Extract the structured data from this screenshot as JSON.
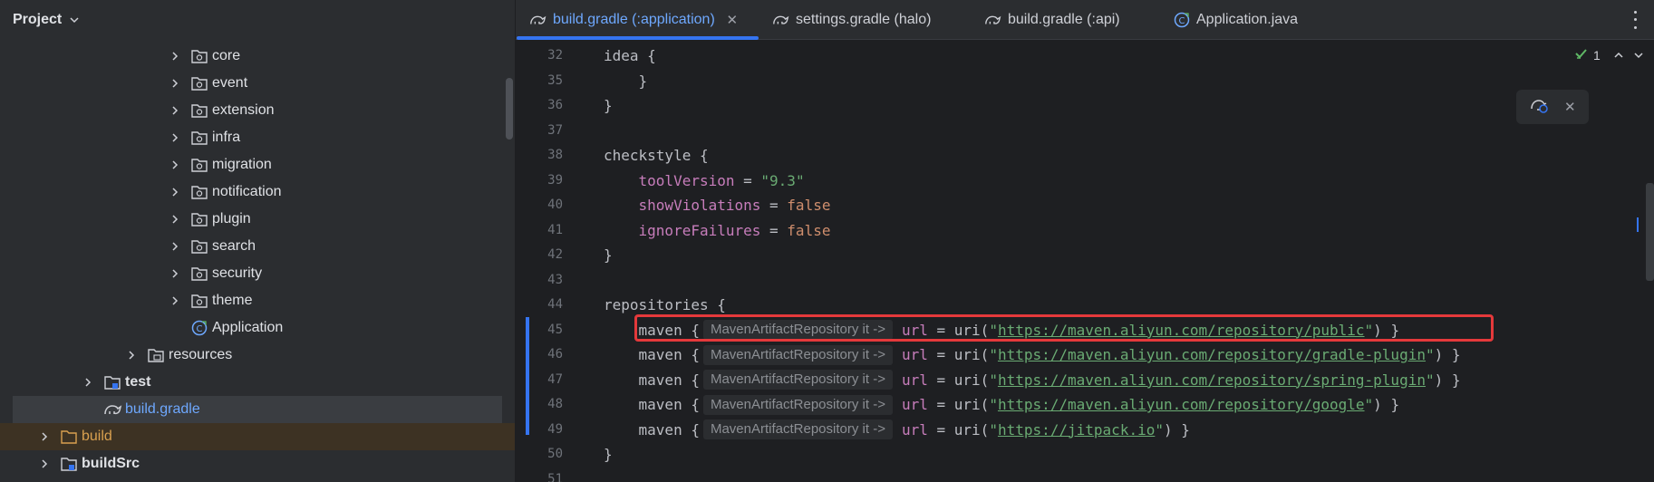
{
  "project": {
    "title": "Project",
    "tree": [
      {
        "label": "core",
        "depth": 3,
        "kind": "package",
        "arrow": true
      },
      {
        "label": "event",
        "depth": 3,
        "kind": "package",
        "arrow": true
      },
      {
        "label": "extension",
        "depth": 3,
        "kind": "package",
        "arrow": true
      },
      {
        "label": "infra",
        "depth": 3,
        "kind": "package",
        "arrow": true
      },
      {
        "label": "migration",
        "depth": 3,
        "kind": "package",
        "arrow": true
      },
      {
        "label": "notification",
        "depth": 3,
        "kind": "package",
        "arrow": true
      },
      {
        "label": "plugin",
        "depth": 3,
        "kind": "package",
        "arrow": true
      },
      {
        "label": "search",
        "depth": 3,
        "kind": "package",
        "arrow": true
      },
      {
        "label": "security",
        "depth": 3,
        "kind": "package",
        "arrow": true
      },
      {
        "label": "theme",
        "depth": 3,
        "kind": "package",
        "arrow": true
      },
      {
        "label": "Application",
        "depth": 3,
        "kind": "class",
        "arrow": false
      },
      {
        "label": "resources",
        "depth": 2,
        "kind": "resources",
        "arrow": true
      },
      {
        "label": "test",
        "depth": 1,
        "kind": "testfolder",
        "arrow": true,
        "bold": true
      },
      {
        "label": "build.gradle",
        "depth": 1,
        "kind": "gradle",
        "arrow": false,
        "selected": true
      },
      {
        "label": "build",
        "depth": 0,
        "kind": "excluded",
        "arrow": true,
        "excluded": true
      },
      {
        "label": "buildSrc",
        "depth": 0,
        "kind": "module",
        "arrow": true,
        "bold": true
      }
    ]
  },
  "tabs": [
    {
      "label": "build.gradle (:application)",
      "icon": "gradle-icon",
      "active": true
    },
    {
      "label": "settings.gradle (halo)",
      "icon": "gradle-icon",
      "active": false
    },
    {
      "label": "build.gradle (:api)",
      "icon": "gradle-icon",
      "active": false
    },
    {
      "label": "Application.java",
      "icon": "java-class-icon",
      "active": false
    }
  ],
  "editor": {
    "inspection_count": "1",
    "lines": [
      {
        "num": "32",
        "segments": [
          {
            "t": "idea {",
            "c": ""
          }
        ]
      },
      {
        "num": "35",
        "segments": [
          {
            "t": "    }",
            "c": ""
          }
        ]
      },
      {
        "num": "36",
        "segments": [
          {
            "t": "}",
            "c": ""
          }
        ]
      },
      {
        "num": "37",
        "segments": []
      },
      {
        "num": "38",
        "segments": [
          {
            "t": "checkstyle {",
            "c": ""
          }
        ]
      },
      {
        "num": "39",
        "segments": [
          {
            "t": "    ",
            "c": ""
          },
          {
            "t": "toolVersion",
            "c": "kw-prop"
          },
          {
            "t": " = ",
            "c": ""
          },
          {
            "t": "\"9.3\"",
            "c": "str"
          }
        ]
      },
      {
        "num": "40",
        "segments": [
          {
            "t": "    ",
            "c": ""
          },
          {
            "t": "showViolations",
            "c": "kw-prop"
          },
          {
            "t": " = ",
            "c": ""
          },
          {
            "t": "false",
            "c": "kw-val"
          }
        ]
      },
      {
        "num": "41",
        "segments": [
          {
            "t": "    ",
            "c": ""
          },
          {
            "t": "ignoreFailures",
            "c": "kw-prop"
          },
          {
            "t": " = ",
            "c": ""
          },
          {
            "t": "false",
            "c": "kw-val"
          }
        ]
      },
      {
        "num": "42",
        "segments": [
          {
            "t": "}",
            "c": ""
          }
        ]
      },
      {
        "num": "43",
        "segments": []
      },
      {
        "num": "44",
        "segments": [
          {
            "t": "repositories {",
            "c": ""
          }
        ]
      },
      {
        "num": "45",
        "segments": [
          {
            "t": "    maven {",
            "c": ""
          },
          {
            "t": "MavenArtifactRepository it ->",
            "c": "hint"
          },
          {
            "t": "url",
            "c": "kw-prop"
          },
          {
            "t": " = uri(",
            "c": ""
          },
          {
            "t": "\"",
            "c": "str"
          },
          {
            "t": "https://maven.aliyun.com/repository/public",
            "c": "url"
          },
          {
            "t": "\"",
            "c": "str"
          },
          {
            "t": ") }",
            "c": ""
          }
        ]
      },
      {
        "num": "46",
        "segments": [
          {
            "t": "    maven {",
            "c": ""
          },
          {
            "t": "MavenArtifactRepository it ->",
            "c": "hint"
          },
          {
            "t": "url",
            "c": "kw-prop"
          },
          {
            "t": " = uri(",
            "c": ""
          },
          {
            "t": "\"",
            "c": "str"
          },
          {
            "t": "https://maven.aliyun.com/repository/gradle-plugin",
            "c": "url"
          },
          {
            "t": "\"",
            "c": "str"
          },
          {
            "t": ") }",
            "c": ""
          }
        ]
      },
      {
        "num": "47",
        "segments": [
          {
            "t": "    maven {",
            "c": ""
          },
          {
            "t": "MavenArtifactRepository it ->",
            "c": "hint"
          },
          {
            "t": "url",
            "c": "kw-prop"
          },
          {
            "t": " = uri(",
            "c": ""
          },
          {
            "t": "\"",
            "c": "str"
          },
          {
            "t": "https://maven.aliyun.com/repository/spring-plugin",
            "c": "url"
          },
          {
            "t": "\"",
            "c": "str"
          },
          {
            "t": ") }",
            "c": ""
          }
        ]
      },
      {
        "num": "48",
        "segments": [
          {
            "t": "    maven {",
            "c": ""
          },
          {
            "t": "MavenArtifactRepository it ->",
            "c": "hint"
          },
          {
            "t": "url",
            "c": "kw-prop"
          },
          {
            "t": " = uri(",
            "c": ""
          },
          {
            "t": "\"",
            "c": "str"
          },
          {
            "t": "https://maven.aliyun.com/repository/google",
            "c": "url"
          },
          {
            "t": "\"",
            "c": "str"
          },
          {
            "t": ") }",
            "c": ""
          }
        ]
      },
      {
        "num": "49",
        "segments": [
          {
            "t": "    maven {",
            "c": ""
          },
          {
            "t": "MavenArtifactRepository it ->",
            "c": "hint"
          },
          {
            "t": "url",
            "c": "kw-prop"
          },
          {
            "t": " = uri(",
            "c": ""
          },
          {
            "t": "\"",
            "c": "str"
          },
          {
            "t": "https://jitpack.io",
            "c": "url"
          },
          {
            "t": "\"",
            "c": "str"
          },
          {
            "t": ") }",
            "c": ""
          }
        ]
      },
      {
        "num": "50",
        "segments": [
          {
            "t": "}",
            "c": ""
          }
        ]
      },
      {
        "num": "51",
        "segments": []
      }
    ]
  },
  "colors": {
    "accent": "#3574f0",
    "highlight_border": "#e5393b",
    "string": "#6aab73",
    "property": "#c77dbb",
    "keyword": "#cf8e6d"
  }
}
